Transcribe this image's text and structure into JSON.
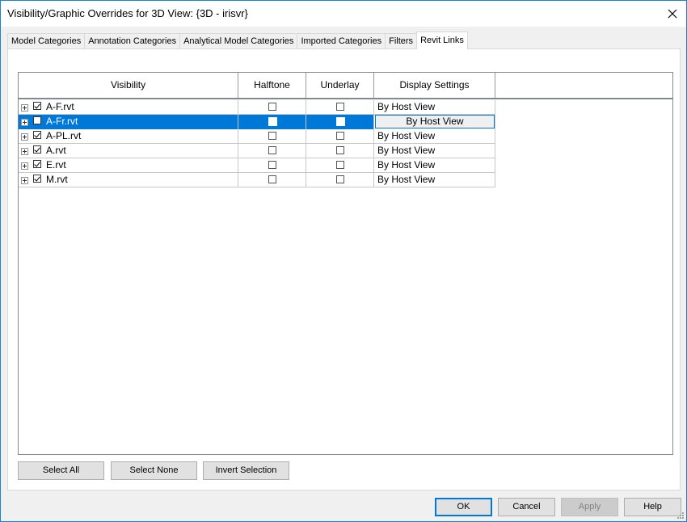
{
  "window": {
    "title": "Visibility/Graphic Overrides for 3D View: {3D - irisvr}",
    "close_icon": "close-icon",
    "border_color": "#1883d7"
  },
  "tabs": [
    {
      "label": "Model Categories",
      "active": false
    },
    {
      "label": "Annotation Categories",
      "active": false
    },
    {
      "label": "Analytical Model Categories",
      "active": false
    },
    {
      "label": "Imported Categories",
      "active": false
    },
    {
      "label": "Filters",
      "active": false
    },
    {
      "label": "Revit Links",
      "active": true
    }
  ],
  "grid": {
    "columns": [
      "Visibility",
      "Halftone",
      "Underlay",
      "Display Settings"
    ],
    "rows": [
      {
        "name": "A-F.rvt",
        "visible": true,
        "halftone": false,
        "underlay": false,
        "display": "By Host View",
        "selected": false
      },
      {
        "name": "A-Fr.rvt",
        "visible": false,
        "halftone": false,
        "underlay": false,
        "display": "By Host View",
        "selected": true
      },
      {
        "name": "A-PL.rvt",
        "visible": true,
        "halftone": false,
        "underlay": false,
        "display": "By Host View",
        "selected": false
      },
      {
        "name": "A.rvt",
        "visible": true,
        "halftone": false,
        "underlay": false,
        "display": "By Host View",
        "selected": false
      },
      {
        "name": "E.rvt",
        "visible": true,
        "halftone": false,
        "underlay": false,
        "display": "By Host View",
        "selected": false
      },
      {
        "name": "M.rvt",
        "visible": true,
        "halftone": false,
        "underlay": false,
        "display": "By Host View",
        "selected": false
      }
    ],
    "selection_color": "#0078d7"
  },
  "selection_buttons": {
    "select_all": "Select All",
    "select_none": "Select None",
    "invert": "Invert Selection"
  },
  "dialog_buttons": {
    "ok": "OK",
    "cancel": "Cancel",
    "apply": "Apply",
    "help": "Help"
  }
}
